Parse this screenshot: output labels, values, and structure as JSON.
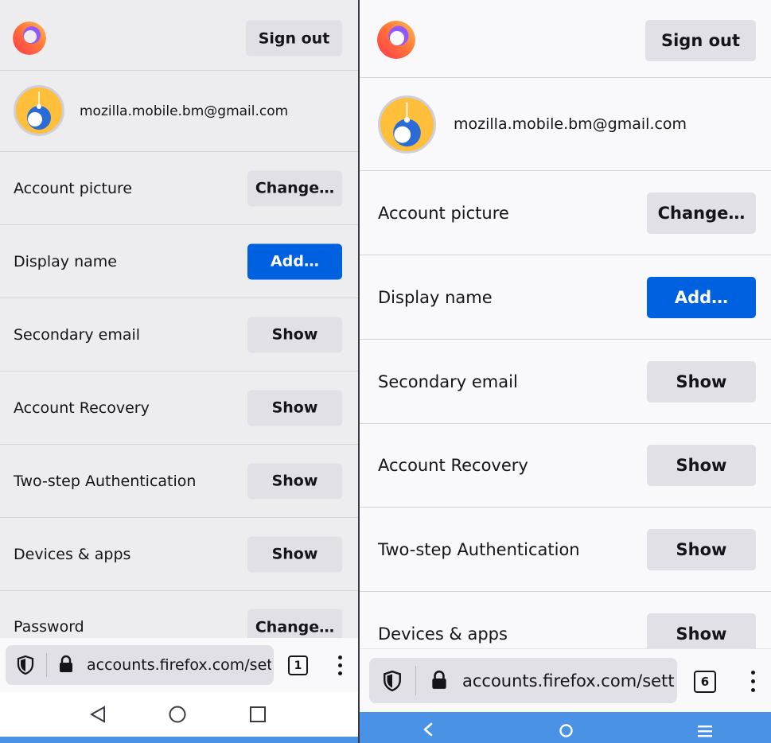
{
  "header": {
    "sign_out_label": "Sign out"
  },
  "account": {
    "email": "mozilla.mobile.bm@gmail.com"
  },
  "rows": {
    "account_picture": {
      "label": "Account picture",
      "button": "Change…"
    },
    "display_name": {
      "label": "Display name",
      "button": "Add…"
    },
    "secondary_email": {
      "label": "Secondary email",
      "button": "Show"
    },
    "account_recovery": {
      "label": "Account Recovery",
      "button": "Show"
    },
    "two_step": {
      "label": "Two-step Authentication",
      "button": "Show"
    },
    "devices_apps": {
      "label": "Devices & apps",
      "button": "Show"
    },
    "password": {
      "label": "Password",
      "button": "Change…"
    }
  },
  "browser": {
    "url": "accounts.firefox.com/settings",
    "left_tab_count": "1",
    "right_tab_count": "6"
  },
  "icons": {
    "logo": "firefox-logo-icon",
    "shield": "tracking-protection-shield-icon",
    "lock": "lock-icon",
    "menu": "kebab-menu-icon",
    "back": "back-icon",
    "home": "home-icon",
    "recents": "recents-icon"
  },
  "colors": {
    "primary_button": "#0061e0",
    "secondary_button": "#e0e0e6",
    "text": "#15141a",
    "right_nav_bar": "#4a92e6"
  }
}
